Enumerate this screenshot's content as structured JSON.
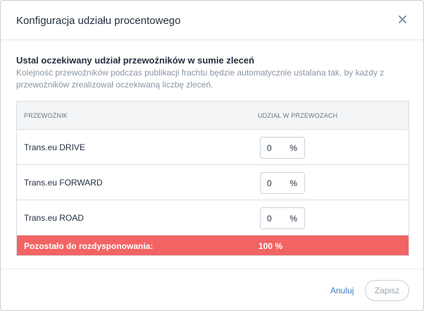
{
  "dialog": {
    "title": "Konfiguracja udziału procentowego",
    "close_icon": "close-icon"
  },
  "content": {
    "heading": "Ustal oczekiwany udział przewoźników w sumie zleceń",
    "description": "Kolejność przewoźników podczas publikacji frachtu będzie automatycznie ustalana tak, by każdy z przewoźników zrealizował oczekiwaną liczbę zleceń."
  },
  "table": {
    "headers": [
      "PRZEWOŹNIK",
      "UDZIAŁ W PRZEWOZACH"
    ],
    "rows": [
      {
        "carrier": "Trans.eu DRIVE",
        "share": "0",
        "unit": "%"
      },
      {
        "carrier": "Trans.eu FORWARD",
        "share": "0",
        "unit": "%"
      },
      {
        "carrier": "Trans.eu ROAD",
        "share": "0",
        "unit": "%"
      }
    ],
    "remaining_label": "Pozostało do rozdysponowania:",
    "remaining_value": "100 %",
    "remaining_color": "#f26463"
  },
  "footer": {
    "cancel_label": "Anuluj",
    "save_label": "Zapisz"
  },
  "colors": {
    "accent": "#3d7ec6",
    "warning": "#f26463"
  }
}
